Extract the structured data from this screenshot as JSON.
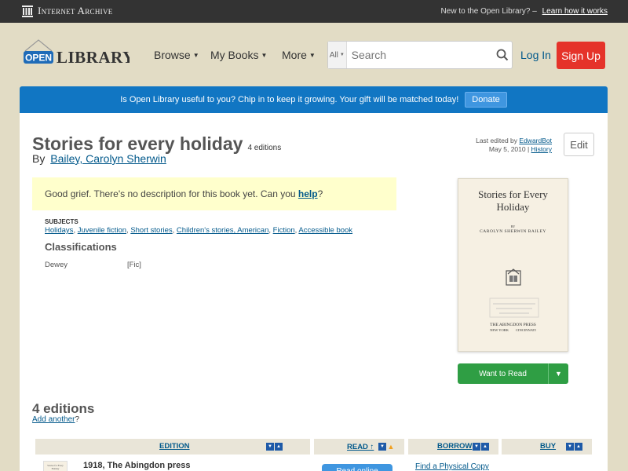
{
  "topbar": {
    "logo_text": "Internet Archive",
    "prompt": "New to the Open Library?",
    "learn_link": "Learn how it works"
  },
  "header": {
    "logo_open": "OPEN",
    "logo_library": "LIBRARY",
    "nav": [
      "Browse",
      "My Books",
      "More"
    ],
    "search_scope": "All",
    "search_placeholder": "Search",
    "login": "Log In",
    "signup": "Sign Up"
  },
  "banner": {
    "message": "Is Open Library useful to you? Chip in to keep it growing. Your gift will be matched today!",
    "donate": "Donate"
  },
  "book": {
    "title": "Stories for every holiday",
    "editions_count": "4 editions",
    "by": "By",
    "author": "Bailey, Carolyn Sherwin",
    "last_edited_prefix": "Last edited by",
    "last_edited_by": "EdwardBot",
    "last_edited_date": "May 5, 2010",
    "history": "History",
    "edit": "Edit",
    "description_text": "Good grief. There's no description for this book yet. Can you",
    "description_link": "help",
    "description_end": "?",
    "subjects_heading": "SUBJECTS",
    "subjects": [
      "Holidays",
      "Juvenile fiction",
      "Short stories",
      "Children's stories, American",
      "Fiction",
      "Accessible book"
    ],
    "classifications_heading": "Classifications",
    "dewey_label": "Dewey",
    "dewey_value": "[Fic]"
  },
  "cover": {
    "title_line1": "Stories for Every",
    "title_line2": "Holiday",
    "by": "BY",
    "author": "CAROLYN SHERWIN BAILEY",
    "press": "THE ABINGDON PRESS",
    "city": "NEW YORK        CINCINNATI"
  },
  "want_to_read": "Want to Read",
  "editions": {
    "heading": "4 editions",
    "add_another": "Add another",
    "add_another_suffix": "?",
    "columns": {
      "edition": "EDITION",
      "read": "READ ↑",
      "borrow": "BORROW",
      "buy": "BUY"
    },
    "rows": [
      {
        "thumb_text": "Stories for Every Holiday",
        "title": "1918, The Abingdon press",
        "read_button": "Read online",
        "find_copy": "Find a Physical Copy"
      }
    ]
  },
  "colors": {
    "topbar": "#333333",
    "page_bg": "#e2dcc5",
    "banner": "#1176c3",
    "signup": "#e5332a",
    "want_to_read": "#2f9e44",
    "link": "#02598b"
  }
}
